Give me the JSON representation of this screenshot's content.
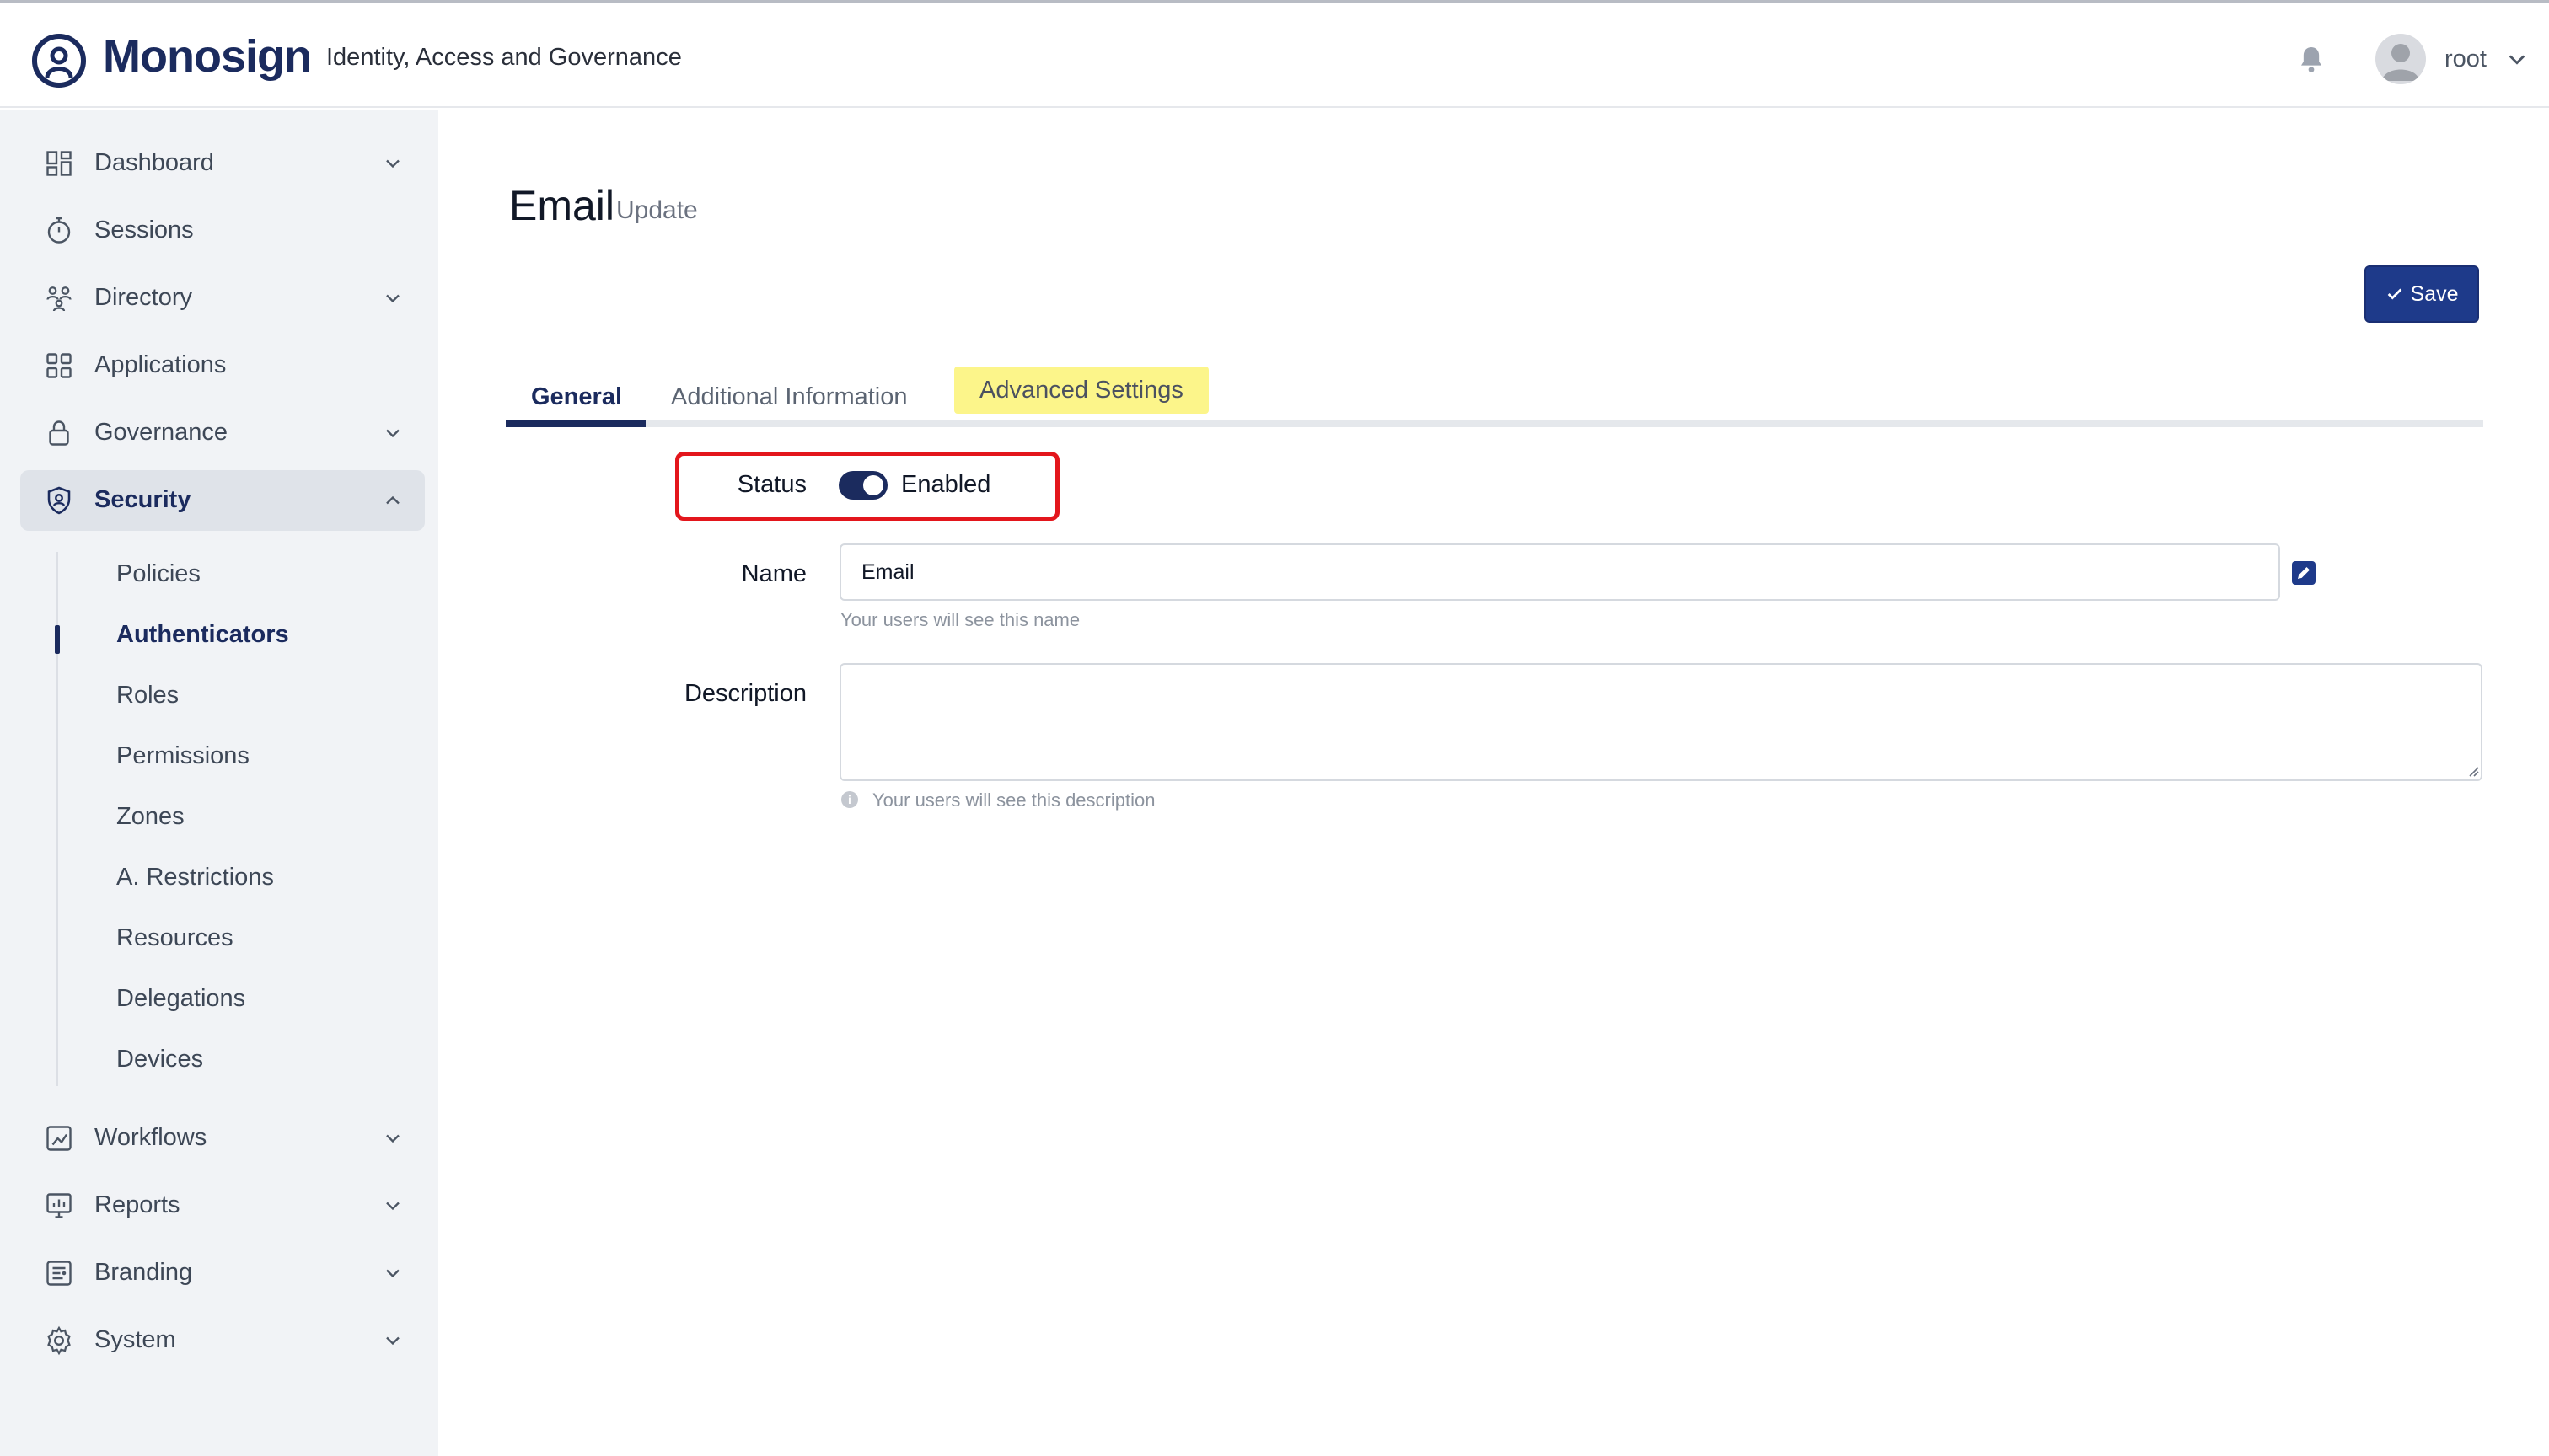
{
  "app": {
    "brand": "Monosign",
    "tagline": "Identity, Access and Governance"
  },
  "header": {
    "user_name": "root"
  },
  "sidebar": {
    "items": [
      {
        "label": "Dashboard",
        "icon": "dashboard-icon",
        "has_chevron": true
      },
      {
        "label": "Sessions",
        "icon": "stopwatch-icon",
        "has_chevron": false
      },
      {
        "label": "Directory",
        "icon": "users-icon",
        "has_chevron": true
      },
      {
        "label": "Applications",
        "icon": "apps-grid-icon",
        "has_chevron": false
      },
      {
        "label": "Governance",
        "icon": "lock-icon",
        "has_chevron": true
      },
      {
        "label": "Security",
        "icon": "shield-user-icon",
        "has_chevron": true,
        "expanded": true
      }
    ],
    "security_sub": [
      {
        "label": "Policies"
      },
      {
        "label": "Authenticators",
        "active": true
      },
      {
        "label": "Roles"
      },
      {
        "label": "Permissions"
      },
      {
        "label": "Zones"
      },
      {
        "label": "A. Restrictions"
      },
      {
        "label": "Resources"
      },
      {
        "label": "Delegations"
      },
      {
        "label": "Devices"
      }
    ],
    "bottom_items": [
      {
        "label": "Workflows",
        "icon": "workflow-icon"
      },
      {
        "label": "Reports",
        "icon": "report-icon"
      },
      {
        "label": "Branding",
        "icon": "branding-icon"
      },
      {
        "label": "System",
        "icon": "gear-icon"
      }
    ]
  },
  "page": {
    "title": "Email",
    "subtitle": "Update",
    "save_label": "Save"
  },
  "tabs": [
    {
      "label": "General",
      "active": true
    },
    {
      "label": "Additional Information"
    },
    {
      "label": "Advanced Settings",
      "highlighted": true
    }
  ],
  "form": {
    "status_label": "Status",
    "status_value": "Enabled",
    "status_on": true,
    "name_label": "Name",
    "name_value": "Email",
    "name_help": "Your users will see this name",
    "description_label": "Description",
    "description_value": "",
    "description_help": "Your users will see this description"
  },
  "colors": {
    "brand": "#1b2b5e",
    "save_button": "#1e3a8a",
    "highlight": "#fcf58a",
    "annotation_box": "#e3161c",
    "sidebar_bg": "#f1f3f6"
  }
}
